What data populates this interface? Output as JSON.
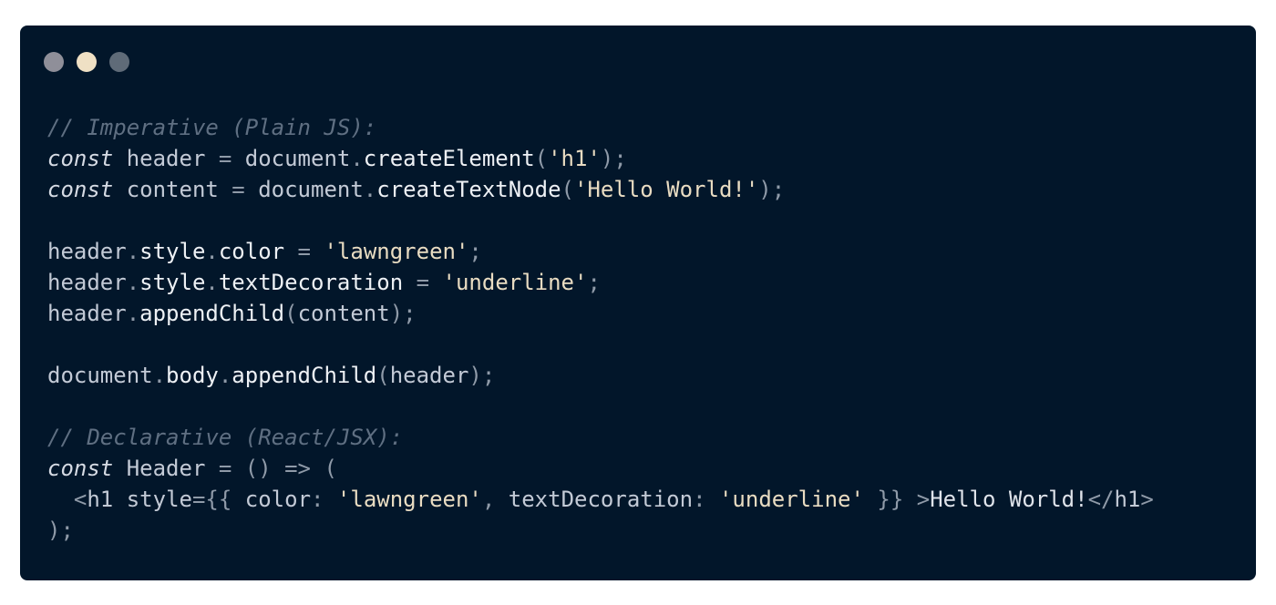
{
  "window": {
    "controls": [
      {
        "name": "close-control",
        "color": "#8f8f99"
      },
      {
        "name": "minimize-control",
        "color": "#efe0c4"
      },
      {
        "name": "maximize-control",
        "color": "#5f6b78"
      }
    ]
  },
  "code": {
    "lines": [
      [
        {
          "t": "// Imperative (Plain JS):",
          "k": "comment"
        }
      ],
      [
        {
          "t": "const",
          "k": "keyword"
        },
        {
          "t": " header ",
          "k": "var"
        },
        {
          "t": "=",
          "k": "punct"
        },
        {
          "t": " document",
          "k": "var"
        },
        {
          "t": ".",
          "k": "punct"
        },
        {
          "t": "createElement",
          "k": "prop"
        },
        {
          "t": "(",
          "k": "punct"
        },
        {
          "t": "'h1'",
          "k": "string"
        },
        {
          "t": ");",
          "k": "punct"
        }
      ],
      [
        {
          "t": "const",
          "k": "keyword"
        },
        {
          "t": " content ",
          "k": "var"
        },
        {
          "t": "=",
          "k": "punct"
        },
        {
          "t": " document",
          "k": "var"
        },
        {
          "t": ".",
          "k": "punct"
        },
        {
          "t": "createTextNode",
          "k": "prop"
        },
        {
          "t": "(",
          "k": "punct"
        },
        {
          "t": "'Hello World!'",
          "k": "string"
        },
        {
          "t": ");",
          "k": "punct"
        }
      ],
      [],
      [
        {
          "t": "header",
          "k": "var"
        },
        {
          "t": ".",
          "k": "punct"
        },
        {
          "t": "style",
          "k": "prop"
        },
        {
          "t": ".",
          "k": "punct"
        },
        {
          "t": "color",
          "k": "prop"
        },
        {
          "t": " = ",
          "k": "punct"
        },
        {
          "t": "'lawngreen'",
          "k": "string"
        },
        {
          "t": ";",
          "k": "punct"
        }
      ],
      [
        {
          "t": "header",
          "k": "var"
        },
        {
          "t": ".",
          "k": "punct"
        },
        {
          "t": "style",
          "k": "prop"
        },
        {
          "t": ".",
          "k": "punct"
        },
        {
          "t": "textDecoration",
          "k": "prop"
        },
        {
          "t": " = ",
          "k": "punct"
        },
        {
          "t": "'underline'",
          "k": "string"
        },
        {
          "t": ";",
          "k": "punct"
        }
      ],
      [
        {
          "t": "header",
          "k": "var"
        },
        {
          "t": ".",
          "k": "punct"
        },
        {
          "t": "appendChild",
          "k": "prop"
        },
        {
          "t": "(",
          "k": "punct"
        },
        {
          "t": "content",
          "k": "var"
        },
        {
          "t": ");",
          "k": "punct"
        }
      ],
      [],
      [
        {
          "t": "document",
          "k": "var"
        },
        {
          "t": ".",
          "k": "punct"
        },
        {
          "t": "body",
          "k": "prop"
        },
        {
          "t": ".",
          "k": "punct"
        },
        {
          "t": "appendChild",
          "k": "prop"
        },
        {
          "t": "(",
          "k": "punct"
        },
        {
          "t": "header",
          "k": "var"
        },
        {
          "t": ");",
          "k": "punct"
        }
      ],
      [],
      [
        {
          "t": "// Declarative (React/JSX):",
          "k": "comment"
        }
      ],
      [
        {
          "t": "const",
          "k": "keyword"
        },
        {
          "t": " Header ",
          "k": "var"
        },
        {
          "t": "=",
          "k": "punct"
        },
        {
          "t": " () => (",
          "k": "punct"
        }
      ],
      [
        {
          "t": "  <",
          "k": "punct"
        },
        {
          "t": "h1",
          "k": "tag"
        },
        {
          "t": " style",
          "k": "var"
        },
        {
          "t": "={{ ",
          "k": "punct"
        },
        {
          "t": "color",
          "k": "var"
        },
        {
          "t": ": ",
          "k": "punct"
        },
        {
          "t": "'lawngreen'",
          "k": "string"
        },
        {
          "t": ", ",
          "k": "punct"
        },
        {
          "t": "textDecoration",
          "k": "var"
        },
        {
          "t": ": ",
          "k": "punct"
        },
        {
          "t": "'underline'",
          "k": "string"
        },
        {
          "t": " }} >",
          "k": "punct"
        },
        {
          "t": "Hello World!",
          "k": "text"
        },
        {
          "t": "</",
          "k": "punct"
        },
        {
          "t": "h1",
          "k": "tag"
        },
        {
          "t": ">",
          "k": "punct"
        }
      ],
      [
        {
          "t": ");",
          "k": "punct"
        }
      ]
    ]
  }
}
